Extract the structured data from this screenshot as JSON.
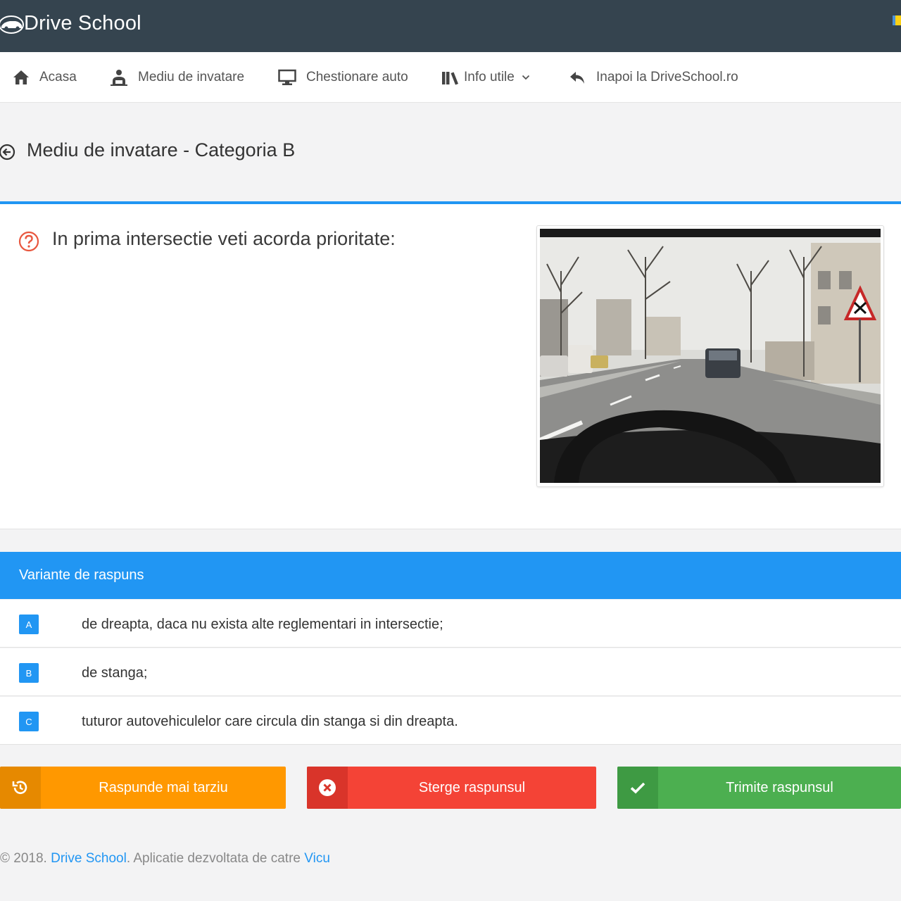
{
  "brand": {
    "name": "Drive School"
  },
  "nav": [
    {
      "label": "Acasa",
      "icon": "home-icon"
    },
    {
      "label": "Mediu de invatare",
      "icon": "learner-icon"
    },
    {
      "label": "Chestionare auto",
      "icon": "monitor-icon"
    },
    {
      "label": "Info utile",
      "icon": "library-icon",
      "dropdown": true
    },
    {
      "label": "Inapoi la DriveSchool.ro",
      "icon": "reply-icon"
    }
  ],
  "page": {
    "title": "Mediu de invatare - Categoria B"
  },
  "question": {
    "text": "In prima intersectie veti acorda prioritate:",
    "icon": "question-circle-icon"
  },
  "answers": {
    "title": "Variante de raspuns",
    "items": [
      {
        "letter": "A",
        "text": "de dreapta, daca nu exista alte reglementari in intersectie;"
      },
      {
        "letter": "B",
        "text": "de stanga;"
      },
      {
        "letter": "C",
        "text": "tuturor autovehiculelor care circula din stanga si din dreapta."
      }
    ]
  },
  "buttons": {
    "later": "Raspunde mai tarziu",
    "clear": "Sterge raspunsul",
    "send": "Trimite raspunsul"
  },
  "footer": {
    "prefix": "© 2018.",
    "brand_link": "Drive School",
    "middle": ". Aplicatie dezvoltata de catre",
    "author_link": "Vicu"
  },
  "colors": {
    "topbar": "#35444f",
    "accent": "#2196f3",
    "orange": "#ff9800",
    "red": "#f44336",
    "green": "#4caf50"
  }
}
